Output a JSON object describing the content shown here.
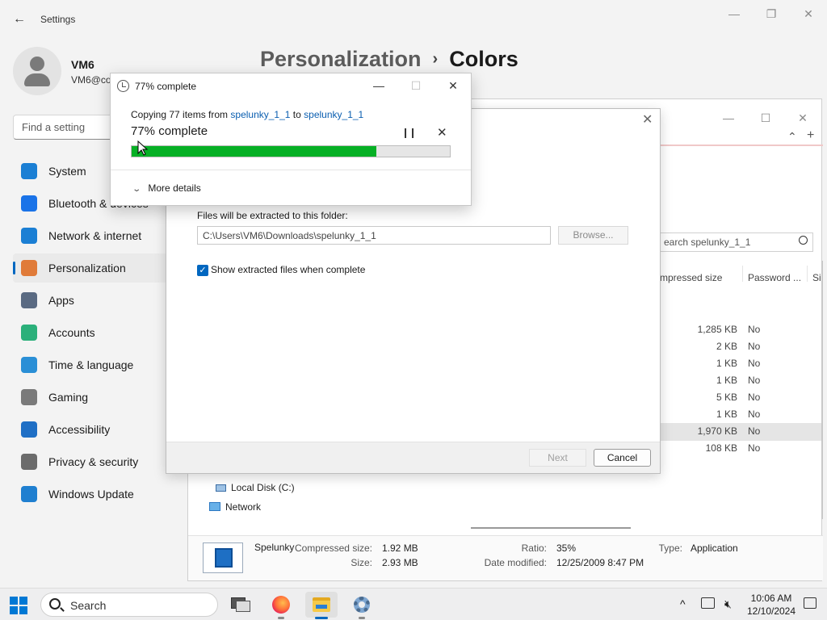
{
  "settings": {
    "window_title": "Settings",
    "user": {
      "name": "VM6",
      "email": "VM6@co"
    },
    "search_placeholder": "Find a setting",
    "breadcrumb": {
      "parent": "Personalization",
      "separator": "›",
      "current": "Colors"
    },
    "nav": [
      {
        "label": "System",
        "icon": "system-icon",
        "color": "#1b7fd4"
      },
      {
        "label": "Bluetooth & devices",
        "icon": "bluetooth-icon",
        "color": "#1a73e8"
      },
      {
        "label": "Network & internet",
        "icon": "wifi-icon",
        "color": "#1b7fd4"
      },
      {
        "label": "Personalization",
        "icon": "paintbrush-icon",
        "color": "#e07b39",
        "active": true
      },
      {
        "label": "Apps",
        "icon": "apps-icon",
        "color": "#5a6a82"
      },
      {
        "label": "Accounts",
        "icon": "accounts-icon",
        "color": "#2bb07a"
      },
      {
        "label": "Time & language",
        "icon": "globe-clock-icon",
        "color": "#2a8fd6"
      },
      {
        "label": "Gaming",
        "icon": "gamepad-icon",
        "color": "#7a7a7a"
      },
      {
        "label": "Accessibility",
        "icon": "accessibility-icon",
        "color": "#1f6fc5"
      },
      {
        "label": "Privacy & security",
        "icon": "shield-icon",
        "color": "#6b6b6b"
      },
      {
        "label": "Windows Update",
        "icon": "update-icon",
        "color": "#1f7fd0"
      }
    ]
  },
  "explorer": {
    "search_placeholder": "earch spelunky_1_1",
    "columns": [
      "mpressed size",
      "Password ...",
      "Si"
    ],
    "rows": [
      {
        "size": "1,285 KB",
        "password": "No"
      },
      {
        "size": "2 KB",
        "password": "No"
      },
      {
        "size": "1 KB",
        "password": "No"
      },
      {
        "size": "1 KB",
        "password": "No"
      },
      {
        "size": "5 KB",
        "password": "No"
      },
      {
        "size": "1 KB",
        "password": "No"
      },
      {
        "size": "1,970 KB",
        "password": "No",
        "selected": true
      },
      {
        "size": "108 KB",
        "password": "No"
      }
    ],
    "tree": [
      {
        "label": "Local Disk (C:)",
        "icon": "drive-icon"
      },
      {
        "label": "Network",
        "icon": "network-icon"
      }
    ],
    "details": {
      "name": "Spelunky",
      "compressed_size_label": "Compressed size:",
      "compressed_size": "1.92 MB",
      "size_label": "Size:",
      "size": "2.93 MB",
      "ratio_label": "Ratio:",
      "ratio": "35%",
      "date_label": "Date modified:",
      "date": "12/25/2009 8:47 PM",
      "type_label": "Type:",
      "type": "Application"
    }
  },
  "extract": {
    "folder_label": "Files will be extracted to this folder:",
    "path": "C:\\Users\\VM6\\Downloads\\spelunky_1_1",
    "browse": "Browse...",
    "show_files_label": "Show extracted files when complete",
    "show_files_checked": true,
    "next": "Next",
    "cancel": "Cancel"
  },
  "progress": {
    "title": "77% complete",
    "copying_prefix": "Copying 77 items from",
    "source": "spelunky_1_1",
    "to": "to",
    "dest": "spelunky_1_1",
    "percent_text": "77% complete",
    "percent": 0.77,
    "more_details": "More details"
  },
  "taskbar": {
    "search_label": "Search",
    "apps": [
      "task-view-icon",
      "firefox-icon",
      "file-explorer-icon",
      "settings-gear-icon"
    ],
    "time": "10:06 AM",
    "date": "12/10/2024"
  }
}
